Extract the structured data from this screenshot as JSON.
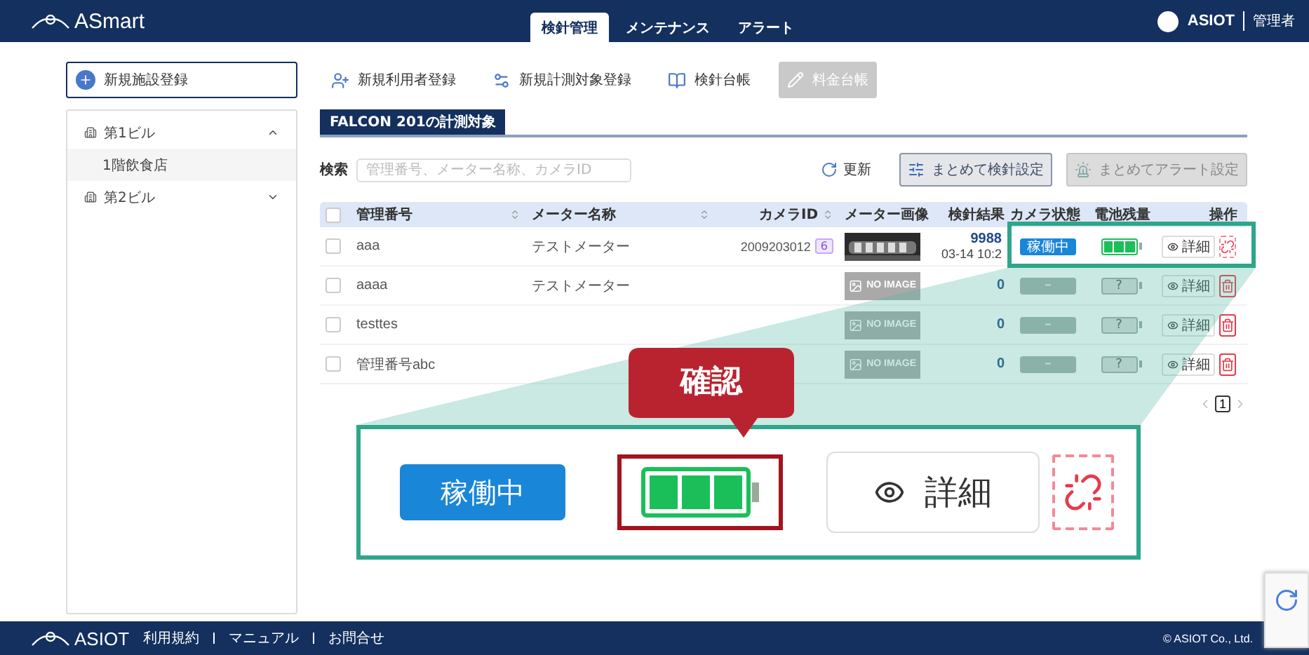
{
  "header": {
    "logo": "ASmart",
    "tabs": [
      {
        "label": "検針管理",
        "selected": true
      },
      {
        "label": "メンテナンス",
        "selected": false
      },
      {
        "label": "アラート",
        "selected": false
      }
    ],
    "user": "ASIOT",
    "role": "管理者"
  },
  "toolbar": [
    {
      "label": "新規施設登録",
      "kind": "facility",
      "disabled": false
    },
    {
      "label": "新規利用者登録",
      "kind": "user",
      "disabled": false
    },
    {
      "label": "新規計測対象登録",
      "kind": "target",
      "disabled": false
    },
    {
      "label": "検針台帳",
      "kind": "ledger",
      "disabled": false
    },
    {
      "label": "料金台帳",
      "kind": "billing",
      "disabled": true
    }
  ],
  "sidebar": {
    "items": [
      {
        "label": "第1ビル",
        "expanded": true,
        "children": [
          {
            "label": "1階飲食店",
            "selected": true
          }
        ]
      },
      {
        "label": "第2ビル",
        "expanded": false
      }
    ]
  },
  "panel": {
    "tab": "FALCON 201の計測対象",
    "search_label": "検索",
    "search_placeholder": "管理番号、メーター名称、カメラID",
    "refresh": "更新",
    "actions": [
      {
        "label": "まとめて検針設定",
        "kind": "settings",
        "disabled": false
      },
      {
        "label": "まとめてアラート設定",
        "kind": "alert",
        "disabled": true
      }
    ]
  },
  "table": {
    "header_checked": false,
    "columns": [
      {
        "label": "管理番号",
        "sortable": true
      },
      {
        "label": "メーター名称",
        "sortable": true
      },
      {
        "label": "カメラID",
        "sortable": true
      },
      {
        "label": "メーター画像",
        "sortable": false
      },
      {
        "label": "検針結果",
        "sortable": false
      },
      {
        "label": "カメラ状態",
        "sortable": false
      },
      {
        "label": "電池残量",
        "sortable": false
      },
      {
        "label": "操作",
        "sortable": false
      }
    ],
    "rows": [
      {
        "checked": false,
        "id": "aaa",
        "meter": "テストメーター",
        "camera_id": "2009203012",
        "camera_badge": "6",
        "result": "9988",
        "time": "03-14 10:2",
        "status": {
          "kind": "active",
          "label": "稼働中"
        },
        "battery": {
          "kind": "level",
          "level": 1
        },
        "detail": "詳細",
        "secondary": {
          "kind": "unlink"
        }
      },
      {
        "checked": false,
        "id": "aaaa",
        "meter": "テストメーター",
        "image": {
          "kind": "none",
          "text": "NO IMAGE"
        },
        "result": "0",
        "status": {
          "kind": "unknown",
          "label": "–"
        },
        "battery": {
          "kind": "unknown",
          "label": "?"
        },
        "detail": "詳細",
        "secondary": {
          "kind": "delete"
        }
      },
      {
        "checked": false,
        "id": "testtes",
        "image": {
          "kind": "none",
          "text": "NO IMAGE"
        },
        "result": "0",
        "status": {
          "kind": "unknown",
          "label": "–"
        },
        "battery": {
          "kind": "unknown",
          "label": "?"
        },
        "detail": "詳細",
        "secondary": {
          "kind": "delete"
        }
      },
      {
        "checked": false,
        "id": "管理番号abc",
        "image": {
          "kind": "none",
          "text": "NO IMAGE"
        },
        "result": "0",
        "status": {
          "kind": "unknown",
          "label": "–"
        },
        "battery": {
          "kind": "unknown",
          "label": "?"
        },
        "detail": "詳細",
        "secondary": {
          "kind": "delete"
        }
      }
    ]
  },
  "pagination": {
    "pages": [
      {
        "label": "1",
        "selected": true
      }
    ]
  },
  "callout": {
    "label": "確認",
    "status": {
      "kind": "active",
      "label": "稼働中"
    },
    "battery": {
      "kind": "level",
      "level": 1
    },
    "detail": "詳細",
    "secondary": {
      "kind": "unlink"
    }
  },
  "footer": {
    "logo": "ASIOT",
    "links": [
      "利用規約",
      "マニュアル",
      "お問合せ"
    ],
    "copyright": "© ASIOT Co., Ltd."
  }
}
